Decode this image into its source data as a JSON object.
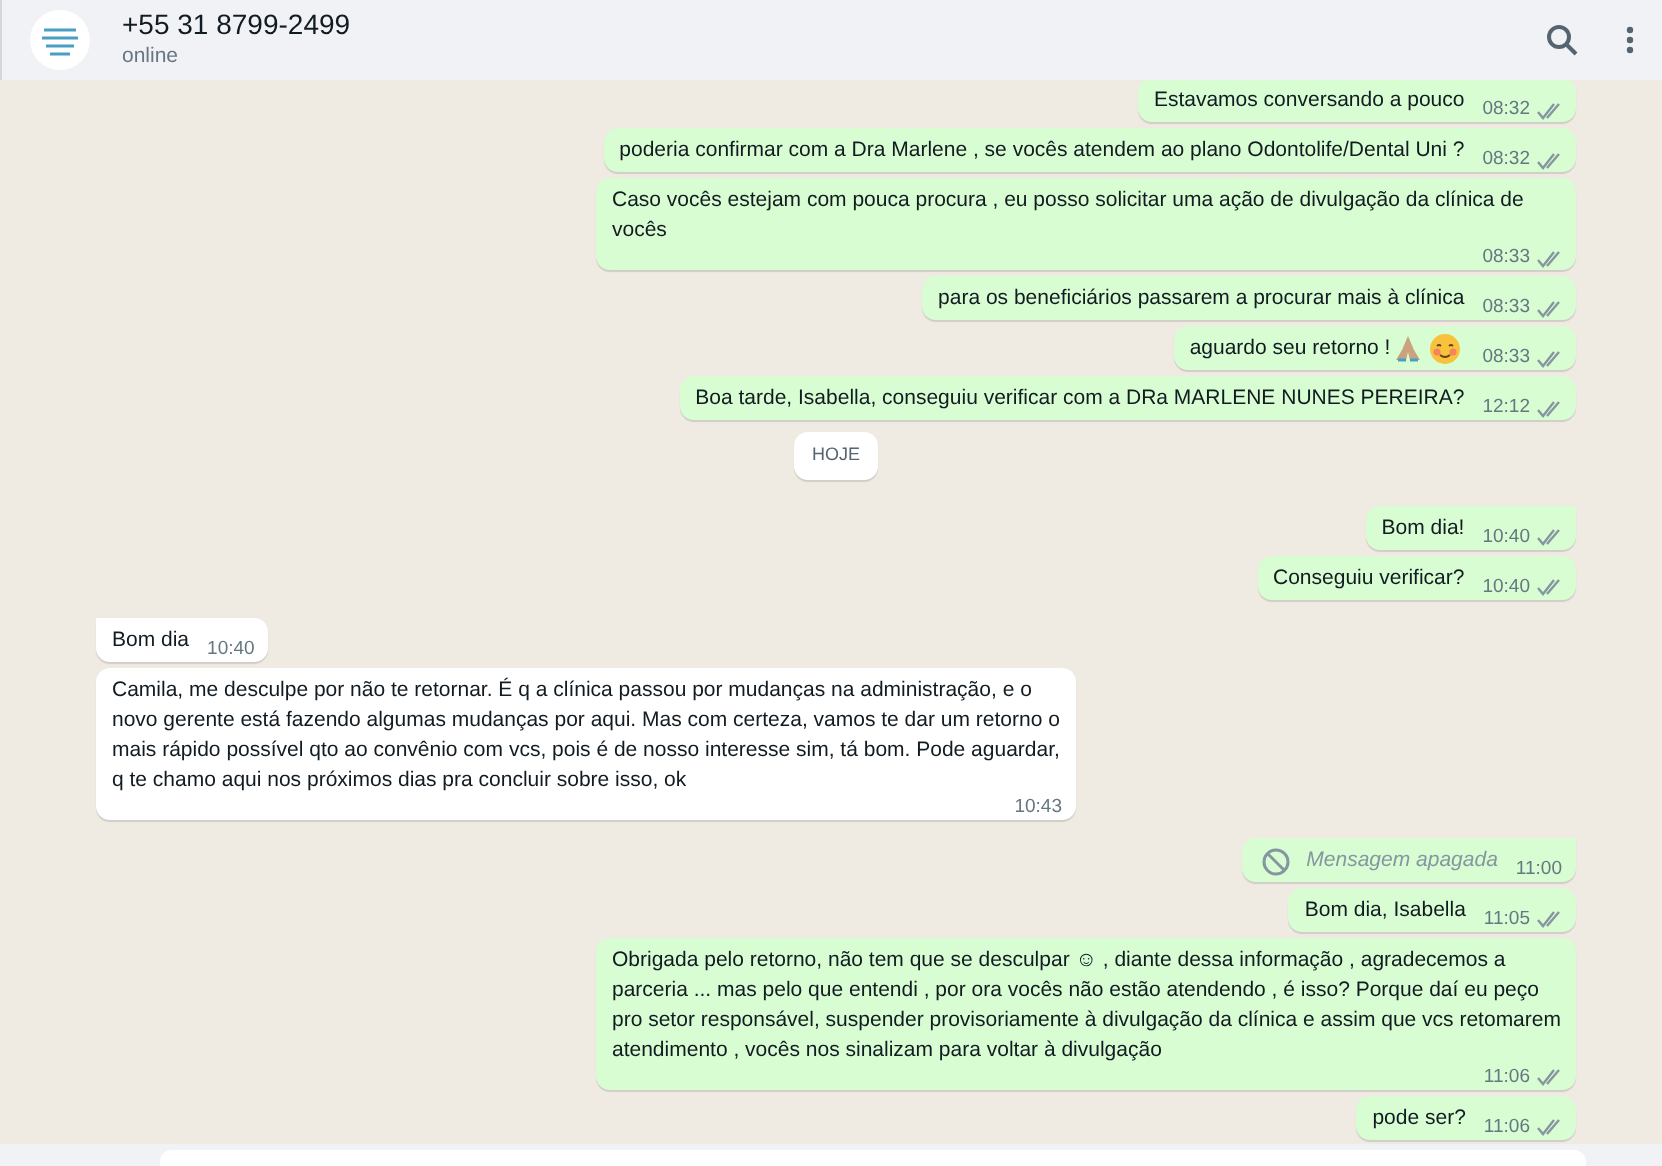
{
  "header": {
    "contact": "+55 31 8799-2499",
    "status": "online"
  },
  "messages": [
    {
      "kind": "out",
      "tail": false,
      "parts": [
        {
          "kind": "text",
          "text": "Estavamos conversando a pouco"
        }
      ],
      "time": "08:32",
      "delivered": true
    },
    {
      "kind": "out",
      "tail": false,
      "parts": [
        {
          "kind": "text",
          "text": "poderia confirmar com a Dra Marlene , se vocês atendem ao plano Odontolife/Dental Uni ?"
        }
      ],
      "time": "08:32",
      "delivered": true
    },
    {
      "kind": "out",
      "tail": false,
      "parts": [
        {
          "kind": "text",
          "text": "Caso vocês estejam com pouca procura , eu posso solicitar uma ação de divulgação da clínica de vocês"
        }
      ],
      "time": "08:33",
      "delivered": true
    },
    {
      "kind": "out",
      "tail": false,
      "parts": [
        {
          "kind": "text",
          "text": "para os beneficiários passarem a procurar mais à clínica"
        }
      ],
      "time": "08:33",
      "delivered": true
    },
    {
      "kind": "out",
      "tail": false,
      "parts": [
        {
          "kind": "text",
          "text": "aguardo seu retorno !"
        },
        {
          "kind": "pray"
        },
        {
          "kind": "blush"
        }
      ],
      "time": "08:33",
      "delivered": true
    },
    {
      "kind": "out",
      "tail": false,
      "parts": [
        {
          "kind": "text",
          "text": "Boa tarde, Isabella, conseguiu verificar com a DRa MARLENE NUNES PEREIRA?"
        }
      ],
      "time": "12:12",
      "delivered": true
    },
    {
      "kind": "date",
      "text": "HOJE"
    },
    {
      "kind": "out",
      "tail": true,
      "parts": [
        {
          "kind": "text",
          "text": "Bom dia!"
        }
      ],
      "time": "10:40",
      "delivered": true
    },
    {
      "kind": "out",
      "tail": false,
      "parts": [
        {
          "kind": "text",
          "text": "Conseguiu verificar?"
        }
      ],
      "time": "10:40",
      "delivered": true
    },
    {
      "kind": "in",
      "tail": true,
      "parts": [
        {
          "kind": "text",
          "text": "Bom dia"
        }
      ],
      "time": "10:40"
    },
    {
      "kind": "in",
      "tail": false,
      "parts": [
        {
          "kind": "text",
          "text": "Camila, me desculpe por não te retornar. É q a clínica passou por mudanças na administração, e o novo gerente está fazendo algumas mudanças por aqui. Mas com certeza, vamos te dar um retorno o mais rápido possível qto ao convênio com vcs, pois é de nosso interesse sim, tá bom. Pode aguardar, q te chamo aqui nos próximos dias pra concluir sobre isso, ok"
        }
      ],
      "time": "10:43"
    },
    {
      "kind": "deleted",
      "tail": true,
      "text": "Mensagem apagada",
      "time": "11:00"
    },
    {
      "kind": "out",
      "tail": false,
      "parts": [
        {
          "kind": "text",
          "text": "Bom dia, Isabella"
        }
      ],
      "time": "11:05",
      "delivered": true
    },
    {
      "kind": "out",
      "tail": false,
      "parts": [
        {
          "kind": "text",
          "text": "Obrigada pelo retorno, não tem que se desculpar ☺ , diante dessa informação , agradecemos a parceria ... mas pelo que entendi , por ora vocês não estão atendendo , é isso? Porque daí eu peço pro setor responsável, suspender provisoriamente à divulgação da clínica e assim que vcs retomarem atendimento , vocês nos sinalizam para voltar à divulgação"
        }
      ],
      "time": "11:06",
      "delivered": true
    },
    {
      "kind": "out",
      "tail": false,
      "parts": [
        {
          "kind": "text",
          "text": "pode ser?"
        }
      ],
      "time": "11:06",
      "delivered": true
    }
  ]
}
